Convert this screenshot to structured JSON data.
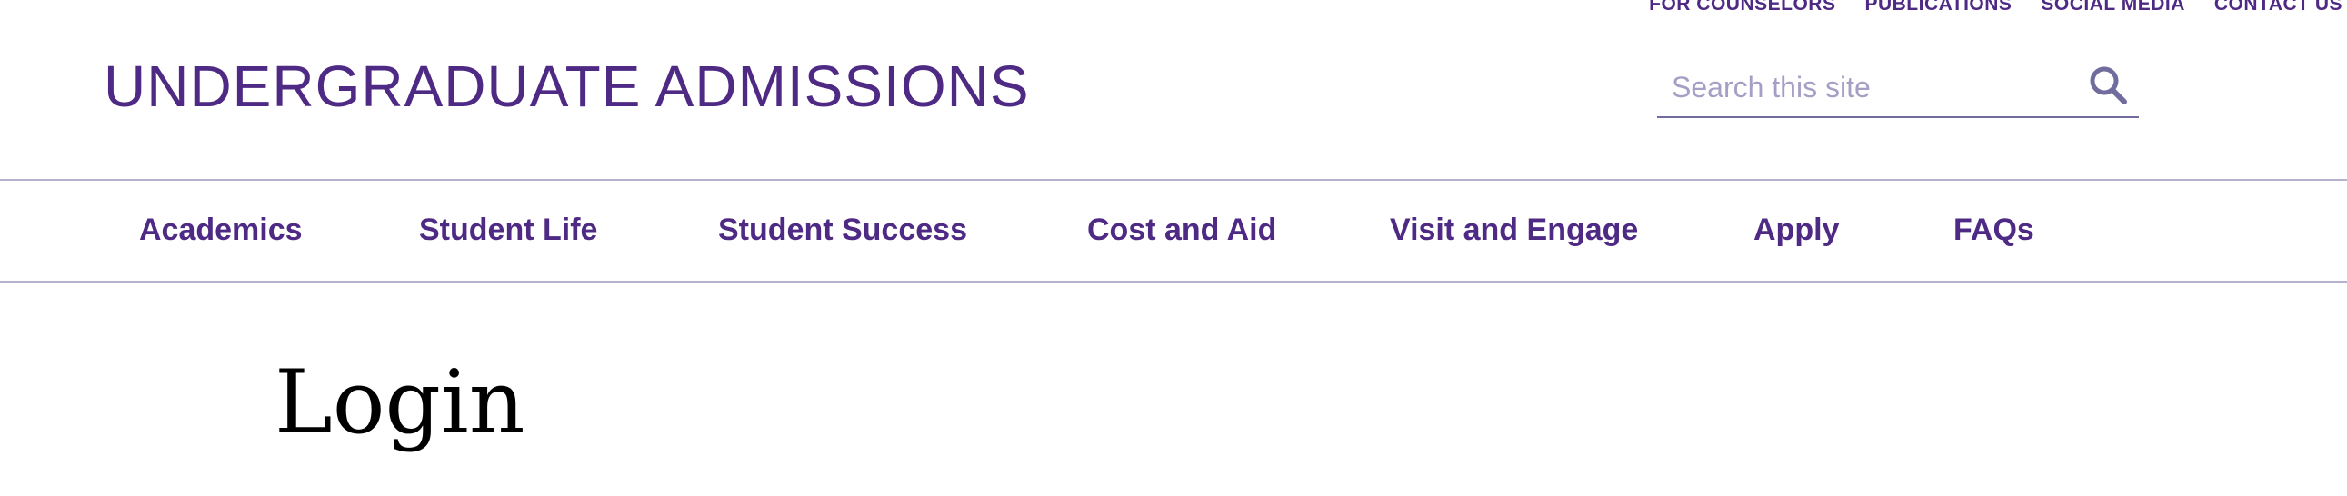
{
  "utility_nav": {
    "items": [
      {
        "label": "FOR COUNSELORS"
      },
      {
        "label": "PUBLICATIONS"
      },
      {
        "label": "SOCIAL MEDIA"
      },
      {
        "label": "CONTACT US"
      }
    ]
  },
  "header": {
    "site_title": "UNDERGRADUATE ADMISSIONS"
  },
  "search": {
    "placeholder": "Search this site",
    "icon": "search-icon"
  },
  "main_nav": {
    "items": [
      {
        "label": "Academics"
      },
      {
        "label": "Student Life"
      },
      {
        "label": "Student Success"
      },
      {
        "label": "Cost and Aid"
      },
      {
        "label": "Visit and Engage"
      },
      {
        "label": "Apply"
      },
      {
        "label": "FAQs"
      }
    ]
  },
  "main": {
    "page_title": "Login"
  },
  "colors": {
    "brand_purple": "#4e2a84",
    "divider": "#b6b1cf",
    "placeholder": "#a49fc4"
  }
}
